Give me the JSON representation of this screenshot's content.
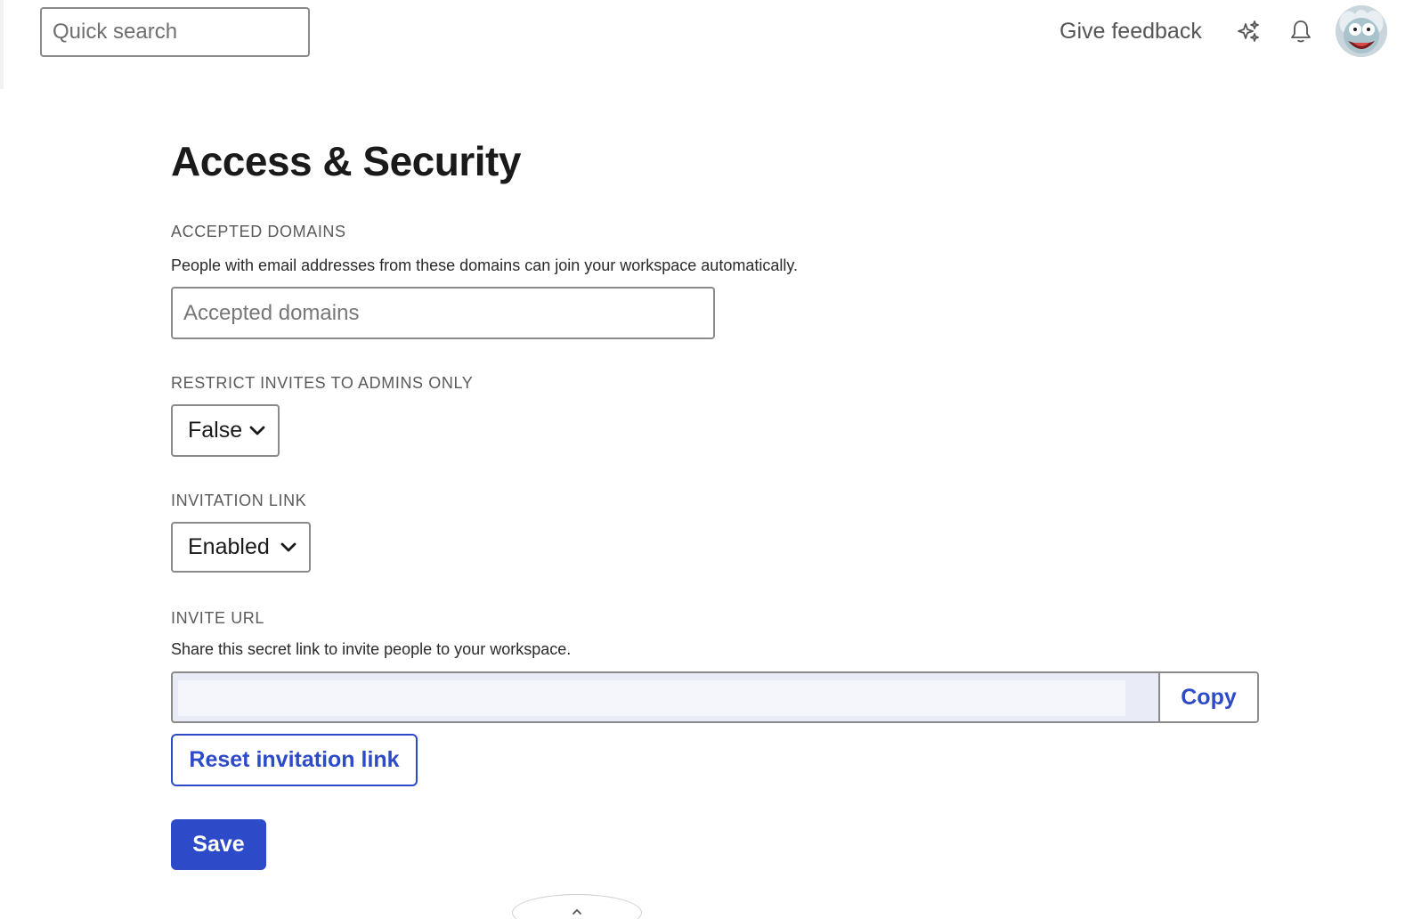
{
  "topbar": {
    "search_placeholder": "Quick search",
    "feedback_label": "Give feedback",
    "icons": [
      "sparkle-icon",
      "bell-icon"
    ],
    "avatar": "user-avatar"
  },
  "page": {
    "title": "Access & Security"
  },
  "accepted_domains": {
    "label": "ACCEPTED DOMAINS",
    "description": "People with email addresses from these domains can join your workspace automatically.",
    "placeholder": "Accepted domains",
    "value": ""
  },
  "restrict_invites": {
    "label": "RESTRICT INVITES TO ADMINS ONLY",
    "selected": "False"
  },
  "invitation_link": {
    "label": "INVITATION LINK",
    "selected": "Enabled"
  },
  "invite_url": {
    "label": "INVITE URL",
    "description": "Share this secret link to invite people to your workspace.",
    "value": "",
    "copy_label": "Copy",
    "reset_label": "Reset invitation link"
  },
  "actions": {
    "save_label": "Save"
  },
  "colors": {
    "accent": "#2d4bc9",
    "border": "#8a8a8a",
    "url_background": "#e9ecf7"
  }
}
